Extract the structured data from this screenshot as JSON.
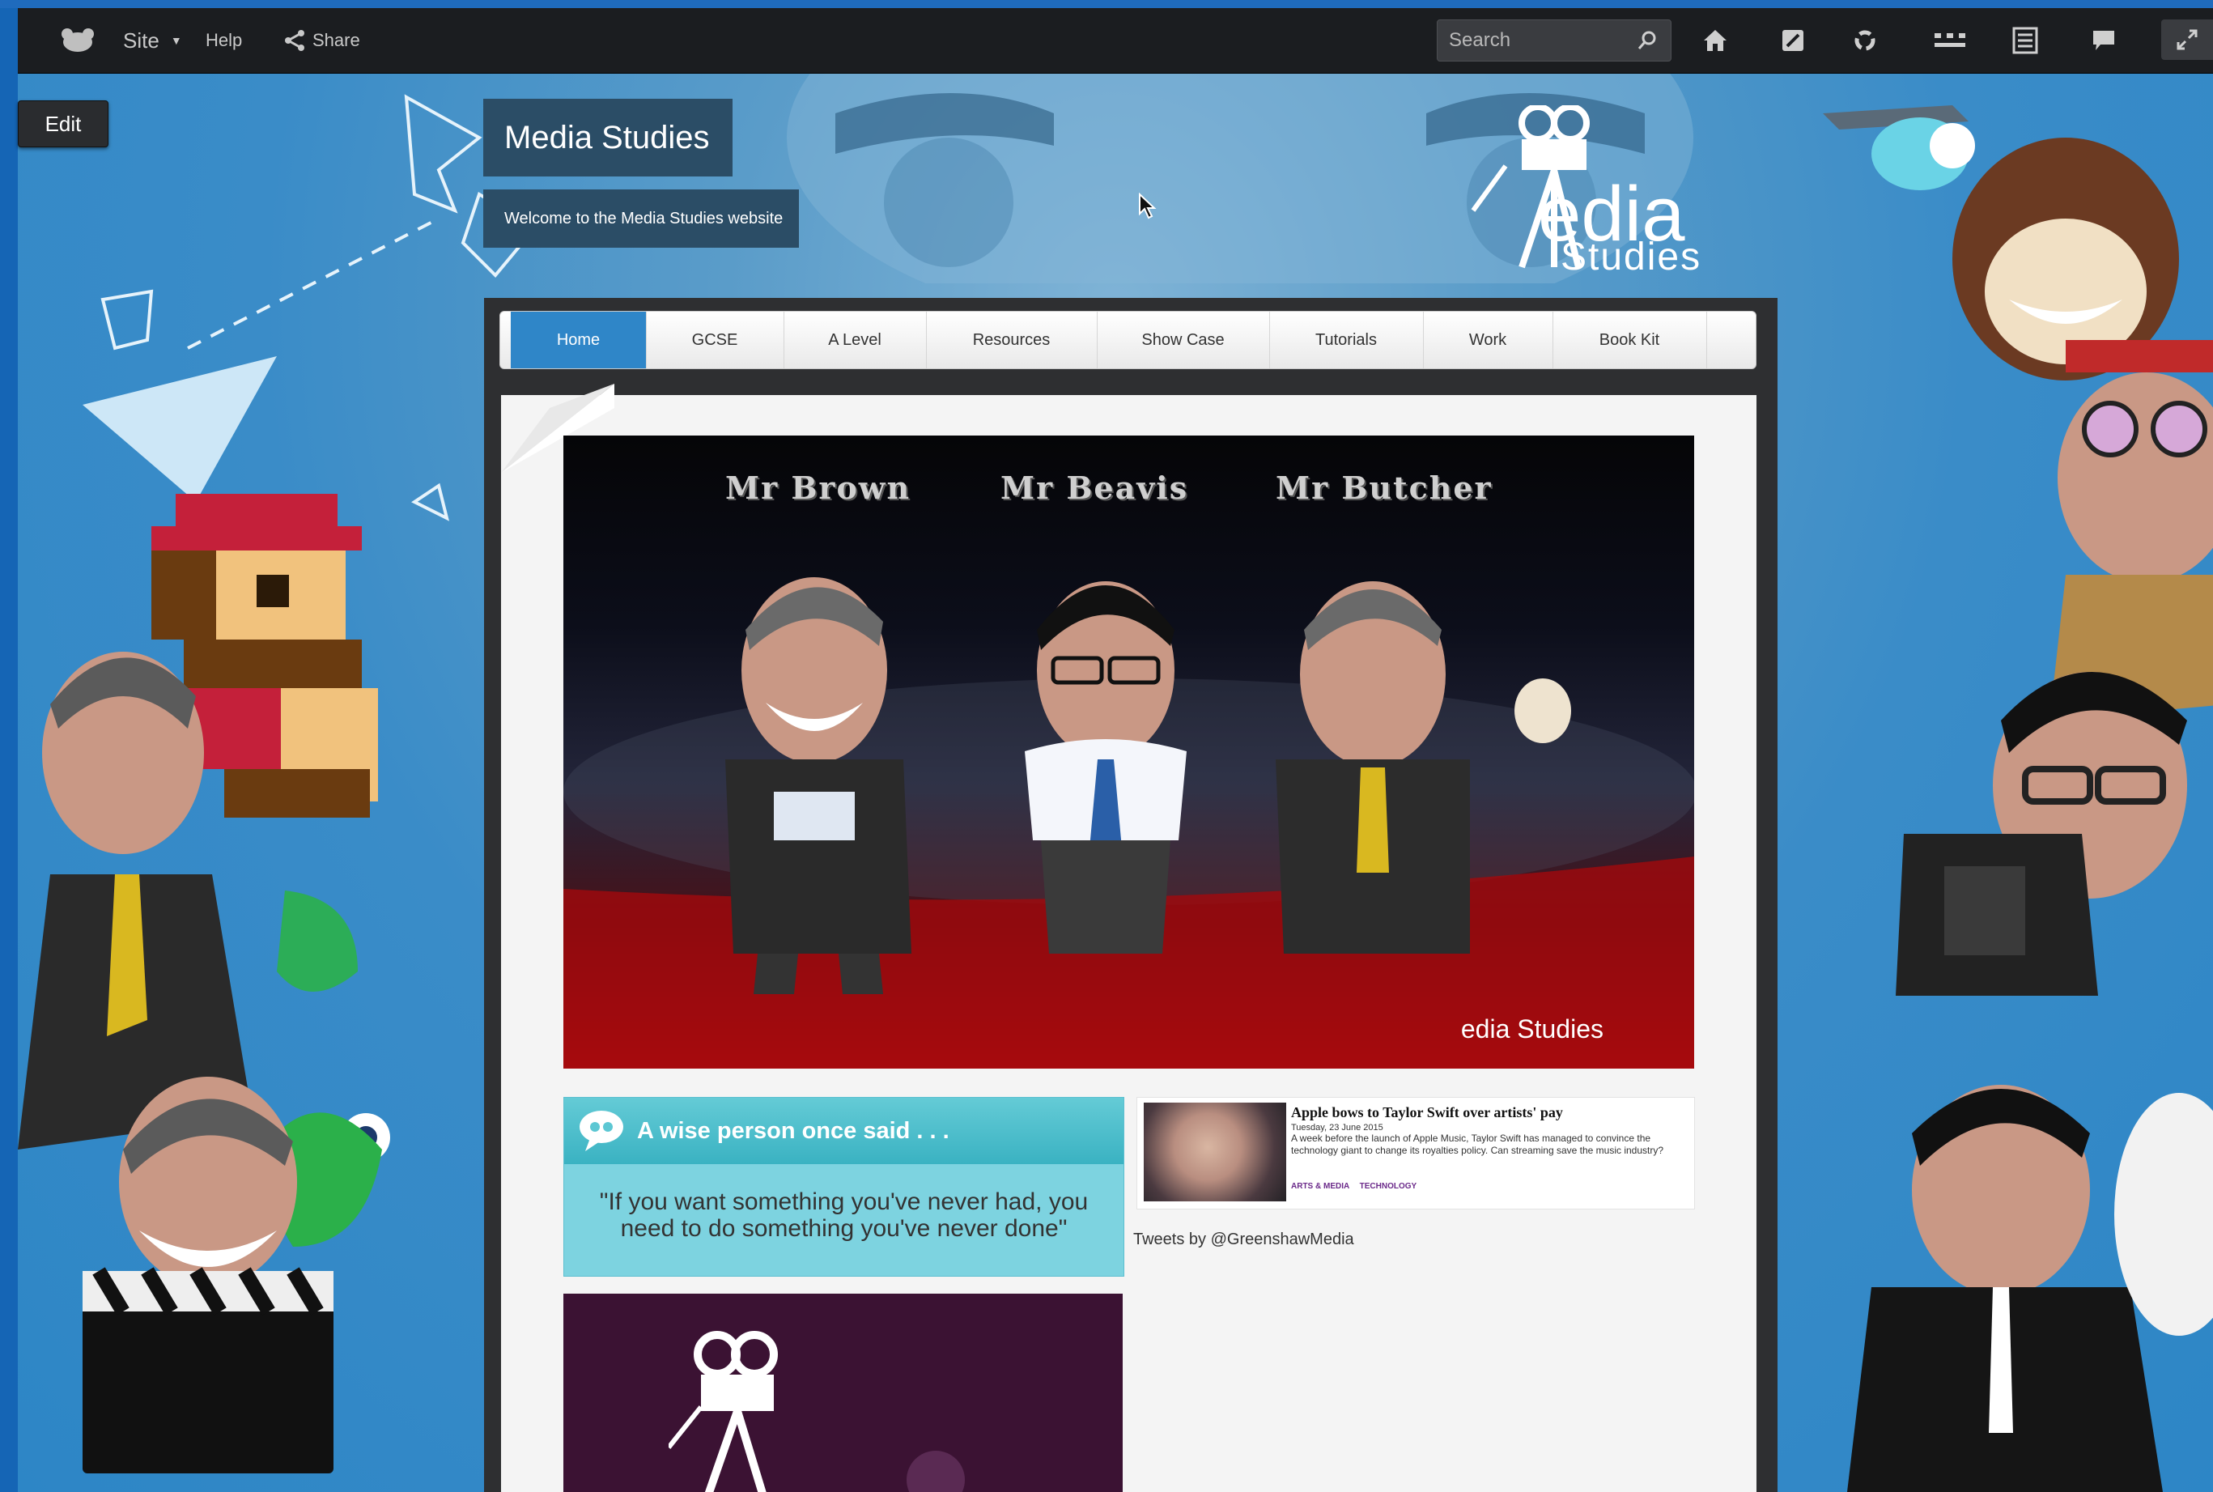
{
  "topbar": {
    "site_label": "Site",
    "help_label": "Help",
    "share_label": "Share",
    "search_placeholder": "Search",
    "icons": [
      "app-logo-icon",
      "home-icon",
      "dashboard-icon",
      "sync-icon",
      "menu-grid-icon",
      "list-icon",
      "comment-icon",
      "fullscreen-icon"
    ]
  },
  "edit_label": "Edit",
  "site_title": "Media Studies",
  "site_subtitle": "Welcome to the Media Studies website",
  "logo": {
    "line1": "edia",
    "line2": "Studies"
  },
  "nav": {
    "items": [
      {
        "label": "Home",
        "active": true
      },
      {
        "label": "GCSE"
      },
      {
        "label": "A Level"
      },
      {
        "label": "Resources"
      },
      {
        "label": "Show Case"
      },
      {
        "label": "Tutorials"
      },
      {
        "label": "Work"
      },
      {
        "label": "Book Kit"
      }
    ]
  },
  "hero": {
    "names": [
      "Mr Brown",
      "Mr Beavis",
      "Mr Butcher"
    ],
    "logo_text": "edia Studies"
  },
  "quote": {
    "heading": "A wise person once said . . .",
    "text": "\"If you want something you've never had, you need to do something you've never done\""
  },
  "news": {
    "title": "Apple bows to Taylor Swift over artists' pay",
    "date": "Tuesday, 23 June 2015",
    "body": "A week before the launch of Apple Music, Taylor Swift has managed to convince the technology giant to change its royalties policy. Can streaming save the music industry?",
    "tags": [
      "ARTS & MEDIA",
      "TECHNOLOGY"
    ]
  },
  "tweets_label": "Tweets by @GreenshawMedia",
  "colors": {
    "accent": "#2f86c8",
    "title_bg": "#2b4d66",
    "quote_bg": "#7dd3e0"
  }
}
